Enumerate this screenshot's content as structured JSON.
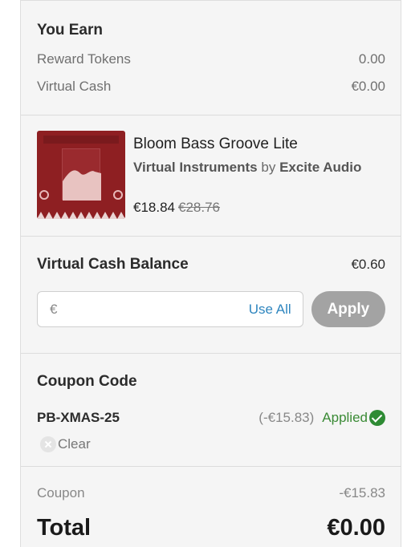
{
  "earn": {
    "title": "You Earn",
    "reward_tokens_label": "Reward Tokens",
    "reward_tokens_value": "0.00",
    "virtual_cash_label": "Virtual Cash",
    "virtual_cash_value": "€0.00"
  },
  "product": {
    "title": "Bloom Bass Groove Lite",
    "category": "Virtual Instruments",
    "by": "by",
    "vendor": "Excite Audio",
    "price": "€18.84",
    "old_price": "€28.76",
    "thumb_color": "#8e1f22"
  },
  "balance": {
    "title": "Virtual Cash Balance",
    "value": "€0.60",
    "input_prefix": "€",
    "use_all_label": "Use All",
    "apply_label": "Apply"
  },
  "coupon": {
    "title": "Coupon Code",
    "code": "PB-XMAS-25",
    "discount": "(-€15.83)",
    "status": "Applied",
    "clear_label": "Clear",
    "status_color": "#2e8b34"
  },
  "totals": {
    "coupon_label": "Coupon",
    "coupon_value": "-€15.83",
    "total_label": "Total",
    "total_value": "€0.00"
  }
}
